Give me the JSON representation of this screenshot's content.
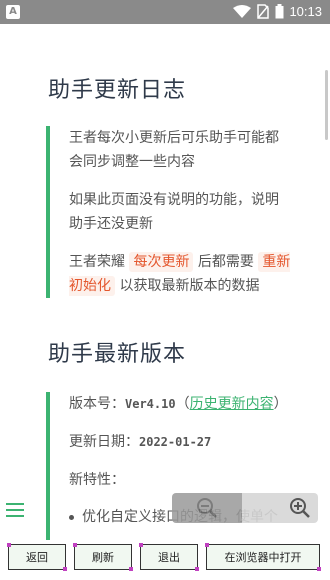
{
  "status_bar": {
    "app_badge": "A",
    "time": "10:13"
  },
  "changelog": {
    "title": "助手更新日志",
    "para1": "王者每次小更新后可乐助手可能都会同步调整一些内容",
    "para2": "如果此页面没有说明的功能，说明助手还没更新",
    "para3_prefix": "王者荣耀",
    "para3_tag1": "每次更新",
    "para3_mid": "后都需要",
    "para3_tag2": "重新初始化",
    "para3_suffix": "以获取最新版本的数据"
  },
  "latest": {
    "title": "助手最新版本",
    "version_label": "版本号：",
    "version_value": "Ver4.10",
    "history_open": "（",
    "history_link": "历史更新内容",
    "history_close": "）",
    "date_label": "更新日期：",
    "date_value": "2022-01-27",
    "features_label": "新特性：",
    "feature_1": "优化自定义接口的逻辑，使单个"
  },
  "toolbar": {
    "back": "返回",
    "refresh": "刷新",
    "exit": "退出",
    "open_browser": "在浏览器中打开"
  },
  "colors": {
    "accent": "#3cb371",
    "tag_text": "#e4572e",
    "status_bar": "#8a8a8a"
  }
}
